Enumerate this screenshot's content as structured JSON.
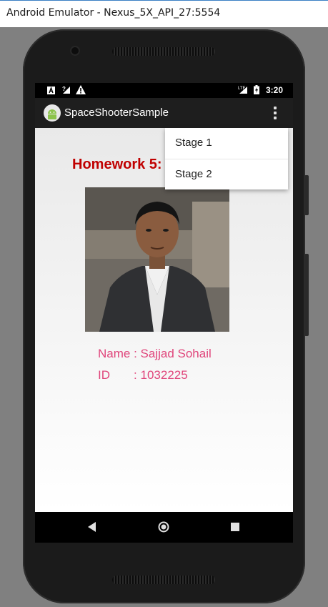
{
  "window": {
    "title": "Android Emulator - Nexus_5X_API_27:5554"
  },
  "status_bar": {
    "time": "3:20",
    "left_icons": [
      "a-notification-icon",
      "no-signal-icon",
      "warning-icon"
    ],
    "right_icons": [
      "lte-off-icon",
      "battery-charging-icon"
    ]
  },
  "app_bar": {
    "title": "SpaceShooterSample",
    "app_icon": "android-icon"
  },
  "content": {
    "heading": "Homework 5:",
    "name_line": "Name : Sajjad Sohail",
    "id_line": "ID       : 1032225"
  },
  "overflow_menu": {
    "items": [
      {
        "label": "Stage 1"
      },
      {
        "label": "Stage 2"
      }
    ]
  },
  "nav_bar": {
    "buttons": [
      "back-icon",
      "home-icon",
      "recents-icon"
    ]
  }
}
